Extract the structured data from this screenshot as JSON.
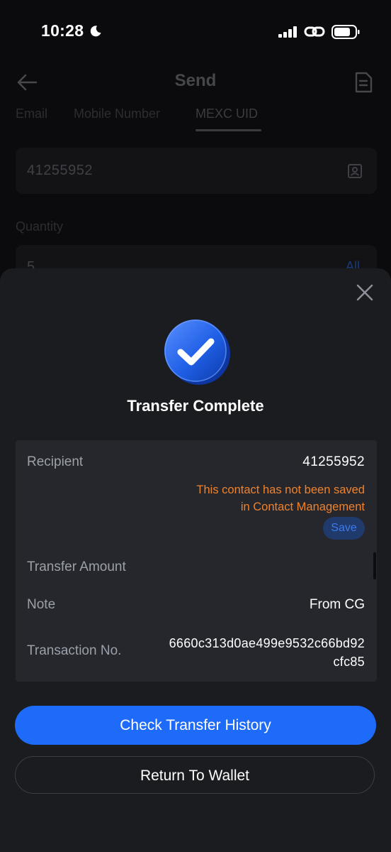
{
  "status_bar": {
    "time": "10:28",
    "icons": [
      "moon-icon",
      "signal-icon",
      "link-icon",
      "battery-icon"
    ]
  },
  "background_page": {
    "title": "Send",
    "tabs": [
      {
        "label": "Email"
      },
      {
        "label": "Mobile Number"
      },
      {
        "label": "MEXC UID",
        "active": true
      }
    ],
    "uid_value": "41255952",
    "quantity_label": "Quantity",
    "quantity_value": "5",
    "all_label": "All"
  },
  "sheet": {
    "title": "Transfer Complete",
    "details": {
      "recipient_label": "Recipient",
      "recipient_value": "41255952",
      "warning_line1": "This contact has not been saved",
      "warning_line2": "in Contact Management",
      "save_label": "Save",
      "amount_label": "Transfer Amount",
      "note_label": "Note",
      "note_value": "From CG",
      "txn_label": "Transaction No.",
      "txn_value": "6660c313d0ae499e9532c66bd92cfc85"
    },
    "primary_button": "Check Transfer History",
    "secondary_button": "Return To Wallet"
  },
  "colors": {
    "accent_blue": "#1f6bf9",
    "warning_orange": "#f0822b",
    "sheet_bg": "#1b1c20",
    "card_bg": "#25272d"
  }
}
